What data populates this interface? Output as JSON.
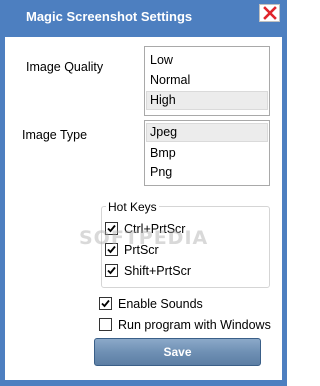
{
  "window": {
    "title": "Magic Screenshot Settings",
    "close_symbol": "✕",
    "title_bar_color": "#4d7fc0",
    "close_color": "#e0242b"
  },
  "image_quality": {
    "label": "Image Quality",
    "options": [
      "Low",
      "Normal",
      "High"
    ],
    "selected": "High"
  },
  "image_type": {
    "label": "Image Type",
    "options": [
      "Jpeg",
      "Bmp",
      "Png"
    ],
    "selected": "Jpeg"
  },
  "hot_keys": {
    "label": "Hot Keys",
    "items": [
      {
        "label": "Ctrl+PrtScr",
        "checked": true
      },
      {
        "label": "PrtScr",
        "checked": true
      },
      {
        "label": "Shift+PrtScr",
        "checked": true
      }
    ]
  },
  "options": {
    "enable_sounds": {
      "label": "Enable Sounds",
      "checked": true
    },
    "run_with_windows": {
      "label": "Run program with Windows",
      "checked": false
    }
  },
  "save_button": {
    "label": "Save"
  },
  "watermark": "SOFTPEDIA"
}
